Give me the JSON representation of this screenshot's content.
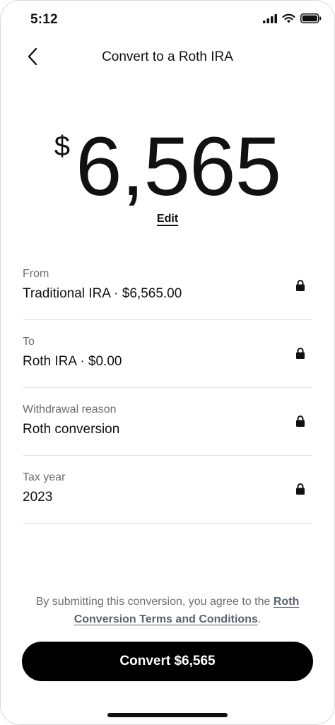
{
  "status_bar": {
    "time": "5:12",
    "icons": [
      "cellular-signal-icon",
      "wifi-icon",
      "battery-icon"
    ]
  },
  "header": {
    "back_icon": "chevron-left-icon",
    "title": "Convert to a Roth IRA"
  },
  "amount": {
    "currency_symbol": "$",
    "value": "6,565",
    "edit_label": "Edit"
  },
  "details": [
    {
      "label": "From",
      "value": "Traditional IRA · $6,565.00",
      "icon": "lock-icon"
    },
    {
      "label": "To",
      "value": "Roth IRA · $0.00",
      "icon": "lock-icon"
    },
    {
      "label": "Withdrawal reason",
      "value": "Roth conversion",
      "icon": "lock-icon"
    },
    {
      "label": "Tax year",
      "value": "2023",
      "icon": "lock-icon"
    }
  ],
  "disclaimer": {
    "text_before": "By submitting this conversion, you agree to the ",
    "link_text": "Roth Conversion Terms and Conditions",
    "text_after": "."
  },
  "cta": {
    "label": "Convert $6,565"
  },
  "colors": {
    "primary_button": "#000000",
    "button_text": "#ffffff",
    "muted_text": "#6e6e6e",
    "divider": "#e3e3e3"
  }
}
